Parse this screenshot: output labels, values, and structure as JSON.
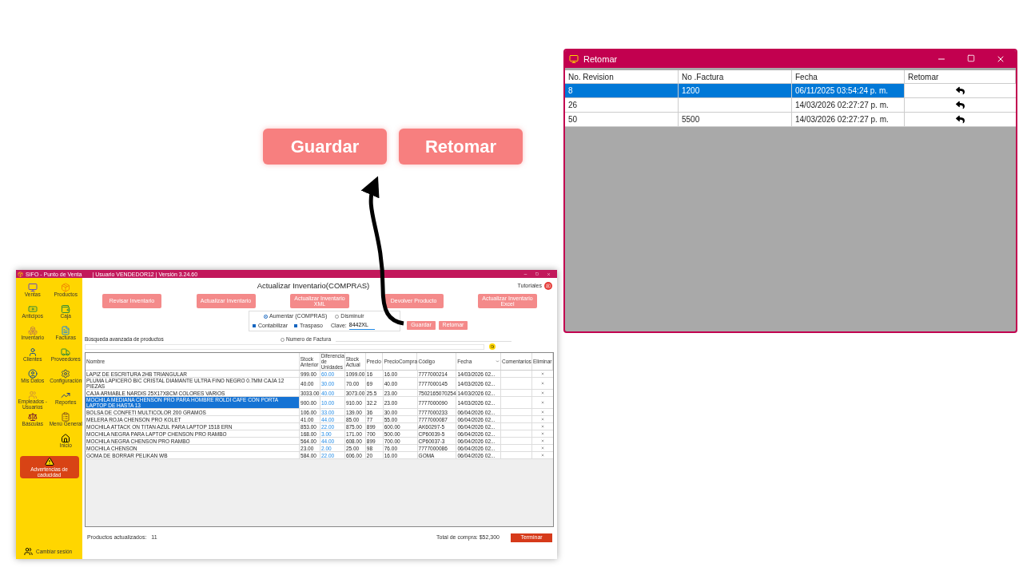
{
  "zoomed_buttons": [
    "Guardar",
    "Retomar"
  ],
  "app_window": {
    "title": "SIFO - Punto de Venta",
    "subtitle": "| Usuario VENDEDOR12 | Versión 3.24.60",
    "sidebar": [
      "Ventas",
      "Productos",
      "Anticipos",
      "Caja",
      "Inventario",
      "Facturas",
      "Clientes",
      "Proveedores",
      "Mis Datos",
      "Configuración",
      "Empleados - Usuarios",
      "Reportes",
      "Básculas",
      "Menú General",
      "Inicio"
    ],
    "warning_button": "Advertencias de caducidad",
    "change_session": "Cambiar sesión",
    "heading": "Actualizar Inventario(COMPRAS)",
    "tutorials": "Tutoriales",
    "action_buttons": [
      "Revisar Inventario",
      "Actualizar Inventario",
      "Actualizar Inventario XML",
      "Devolver Producto",
      "Actualizar Inventario Excel"
    ],
    "options": {
      "radios": [
        {
          "label": "Aumentar (COMPRAS)",
          "selected": true
        },
        {
          "label": "Disminuir",
          "selected": false
        }
      ],
      "checkboxes": [
        {
          "label": "Contabilizar",
          "checked": true
        },
        {
          "label": "Traspaso",
          "checked": true
        }
      ],
      "key_label": "Clave:",
      "key_value": "8442XL"
    },
    "save_buttons": [
      "Guardar",
      "Retomar"
    ],
    "search": {
      "label": "Búsqueda avanzada de productos",
      "invoice_option": {
        "label": "Numero de Factura",
        "selected": false
      }
    },
    "table": {
      "columns": [
        "Nombre",
        "Stock Anterior",
        "Diferencia de Unidades",
        "Stock Actual",
        "Precio",
        "PrecioCompra",
        "Código",
        "Fecha",
        "Comentarios",
        "Eliminar"
      ],
      "rows": [
        {
          "selected": false,
          "cells": [
            "LAPIZ DE ESCRITURA 2HB TRIANGULAR",
            "999.00",
            "60.00",
            "1099.00",
            "16",
            "16.00",
            "7777000214",
            "14/03/2026 02..."
          ]
        },
        {
          "selected": false,
          "cells": [
            "PLUMA LAPICERO BIC CRISTAL DIAMANTE ULTRA FINO NEGRO 0.7MM CAJA 12 PIEZAS",
            "40.00",
            "30.00",
            "70.00",
            "69",
            "40.00",
            "7777000145",
            "14/03/2026 02..."
          ]
        },
        {
          "selected": false,
          "cells": [
            "CAJA ARMABLE NARDIS 25X17X8CM COLORES VARIOS",
            "3033.00",
            "40.00",
            "3073.00",
            "25.5",
            "23.00",
            "7502165070254",
            "14/03/2026 02..."
          ]
        },
        {
          "selected": true,
          "cells": [
            "MOCHILA MEDIANA CHENSON PRO PARA HOMBRE ROLDI CAFE CON PORTA LAPTOP DE HASTA 13",
            "900.00",
            "10.00",
            "910.00",
            "32.2",
            "23.00",
            "7777000090",
            "14/03/2026 02..."
          ]
        },
        {
          "selected": false,
          "cells": [
            "BOLSA DE CONFETI MULTICOLOR 200 GRAMOS",
            "106.00",
            "33.00",
            "139.00",
            "36",
            "30.00",
            "7777000233",
            "06/04/2026 02..."
          ]
        },
        {
          "selected": false,
          "cells": [
            "MELERA ROJA CHENSON PRO KOLET",
            "41.00",
            "44.00",
            "85.00",
            "77",
            "55.00",
            "7777000087",
            "06/04/2026 02..."
          ]
        },
        {
          "selected": false,
          "cells": [
            "MOCHILA ATTACK ON TITAN AZUL PARA LAPTOP 1518 ERN",
            "853.00",
            "22.00",
            "875.00",
            "899",
            "600.00",
            "AK60297-5",
            "06/04/2026 02..."
          ]
        },
        {
          "selected": false,
          "cells": [
            "MOCHILA NEGRA PARA LAPTOP CHENSON PRO RAMBO",
            "168.00",
            "3.00",
            "171.00",
            "700",
            "500.00",
            "CP60039-5",
            "06/04/2026 02..."
          ]
        },
        {
          "selected": false,
          "cells": [
            "MOCHILA NEGRA CHENSON PRO RAMBO",
            "564.00",
            "44.00",
            "608.00",
            "899",
            "700.00",
            "CP60037-3",
            "06/04/2026 02..."
          ]
        },
        {
          "selected": false,
          "cells": [
            "MOCHILA CHENSON",
            "23.00",
            "2.00",
            "25.00",
            "98",
            "76.00",
            "7777000086",
            "06/04/2026 02..."
          ]
        },
        {
          "selected": false,
          "cells": [
            "GOMA DE BORRAR PELIKAN WB",
            "584.00",
            "22.00",
            "606.00",
            "20",
            "16.00",
            "GOMA",
            "06/04/2026 02..."
          ]
        }
      ]
    },
    "footer": {
      "updated_label": "Productos actualizados:",
      "updated_count": "11",
      "total": "Total de compra: $52,300",
      "finish_button": "Terminar"
    }
  },
  "dialog": {
    "title": "Retomar",
    "columns": [
      "No. Revision",
      "No .Factura",
      "Fecha",
      "Retomar"
    ],
    "rows": [
      {
        "selected": true,
        "revision": "8",
        "invoice": "1200",
        "date": "06/11/2025 03:54:24 p. m."
      },
      {
        "selected": false,
        "revision": "26",
        "date": "14/03/2026 02:27:27 p. m."
      },
      {
        "selected": false,
        "revision": "50",
        "invoice": "5500",
        "date": "14/03/2026 02:27:27 p. m."
      }
    ]
  }
}
